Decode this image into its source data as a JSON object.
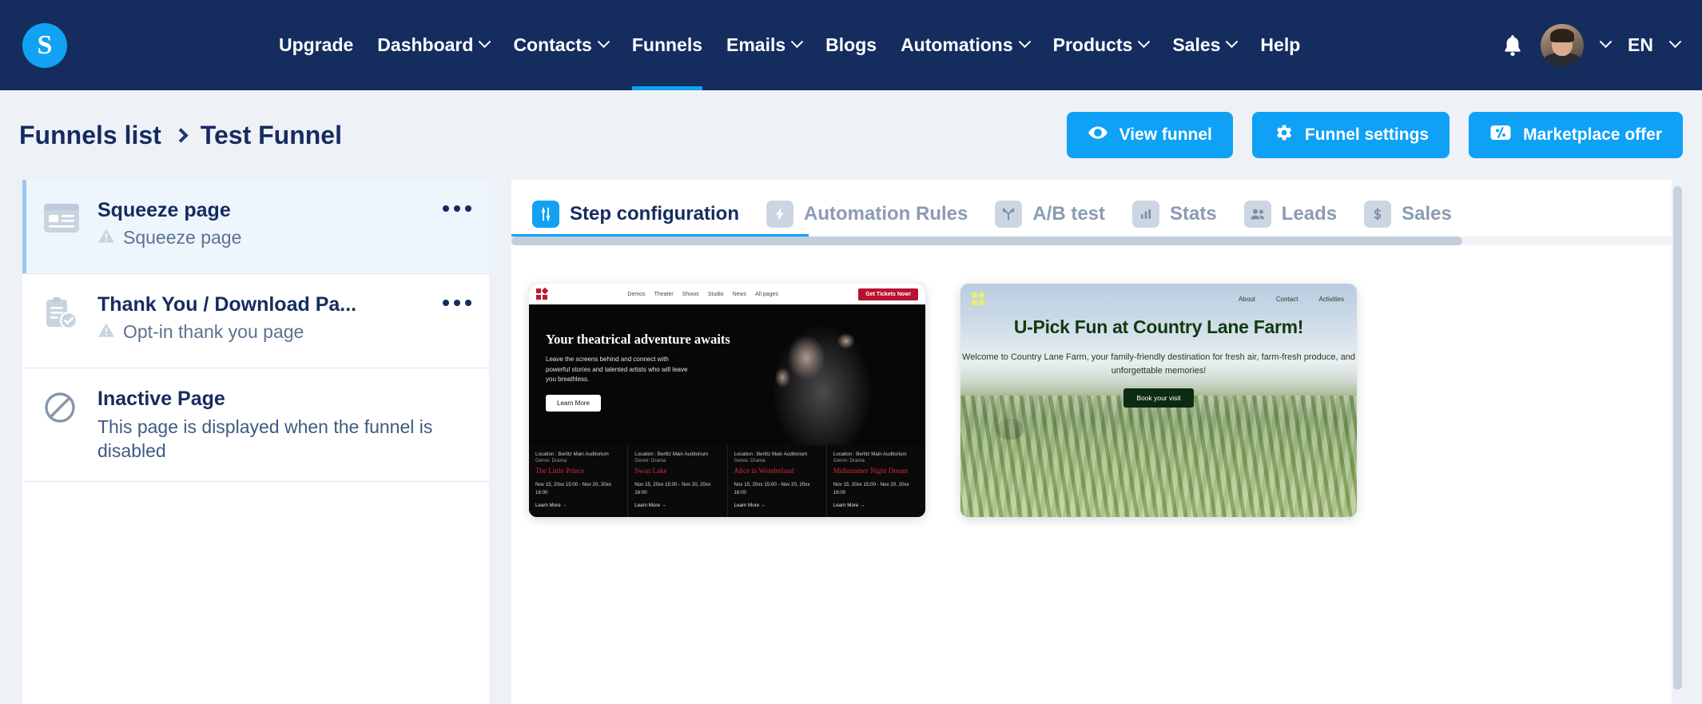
{
  "navbar": {
    "logo_letter": "S",
    "items": [
      {
        "label": "Upgrade",
        "caret": false,
        "active": false
      },
      {
        "label": "Dashboard",
        "caret": true,
        "active": false
      },
      {
        "label": "Contacts",
        "caret": true,
        "active": false
      },
      {
        "label": "Funnels",
        "caret": false,
        "active": true
      },
      {
        "label": "Emails",
        "caret": true,
        "active": false
      },
      {
        "label": "Blogs",
        "caret": false,
        "active": false
      },
      {
        "label": "Automations",
        "caret": true,
        "active": false
      },
      {
        "label": "Products",
        "caret": true,
        "active": false
      },
      {
        "label": "Sales",
        "caret": true,
        "active": false
      },
      {
        "label": "Help",
        "caret": false,
        "active": false
      }
    ],
    "notification_icon": "bell-icon",
    "avatar_icon": "user-avatar",
    "language": "EN"
  },
  "subheader": {
    "breadcrumb_root": "Funnels list",
    "breadcrumb_current": "Test Funnel",
    "buttons": [
      {
        "label": "View funnel",
        "icon": "eye-icon"
      },
      {
        "label": "Funnel settings",
        "icon": "gear-icon"
      },
      {
        "label": "Marketplace offer",
        "icon": "ticket-percent-icon"
      }
    ]
  },
  "sidebar": {
    "pages": [
      {
        "title": "Squeeze page",
        "subtitle": "Squeeze page",
        "warning": true,
        "icon": "squeeze-page-icon",
        "selected": true,
        "menu": "..."
      },
      {
        "title": "Thank You / Download Pa...",
        "subtitle": "Opt-in thank you page",
        "warning": true,
        "icon": "thank-you-page-icon",
        "selected": false,
        "menu": "..."
      },
      {
        "title": "Inactive Page",
        "description": "This page is displayed when the funnel is disabled",
        "warning": false,
        "icon": "blocked-icon",
        "selected": false
      }
    ]
  },
  "main": {
    "tabs": [
      {
        "label": "Step configuration",
        "icon": "sliders-icon",
        "active": true
      },
      {
        "label": "Automation Rules",
        "icon": "bolt-icon",
        "active": false
      },
      {
        "label": "A/B test",
        "icon": "branch-icon",
        "active": false
      },
      {
        "label": "Stats",
        "icon": "bar-chart-icon",
        "active": false
      },
      {
        "label": "Leads",
        "icon": "people-icon",
        "active": false
      },
      {
        "label": "Sales",
        "icon": "dollar-icon",
        "active": false
      }
    ],
    "templates": [
      {
        "id": "theatre-template",
        "nav_links": [
          "Demos",
          "Theater",
          "Shows",
          "Studio",
          "News",
          "All pages"
        ],
        "cta": "Get Tickets Now!",
        "heading": "Your theatrical adventure awaits",
        "paragraph": "Leave the screens behind and connect with powerful stories and talented artists who will leave you breathless.",
        "button": "Learn More",
        "cards": [
          {
            "location": "Location : Berlitz Main Auditorium",
            "genre": "Genre: Drama",
            "name": "The Little Prince",
            "date": "Nov 15, 20xx 15:00 - Nov 20, 20xx 16:00",
            "more": "Learn More  →"
          },
          {
            "location": "Location : Berlitz Main Auditorium",
            "genre": "Genre: Drama",
            "name": "Swan Lake",
            "date": "Nov 15, 20xx 15:00 - Nov 20, 20xx 16:00",
            "more": "Learn More  →"
          },
          {
            "location": "Location : Berlitz Main Auditorium",
            "genre": "Genre: Drama",
            "name": "Alice in Wonderland",
            "date": "Nov 15, 20xx 15:00 - Nov 20, 20xx 16:00",
            "more": "Learn More  →"
          },
          {
            "location": "Location : Berlitz Main Auditorium",
            "genre": "Genre: Drama",
            "name": "Midsummer Night Dream",
            "date": "Nov 15, 20xx 15:00 - Nov 20, 20xx 16:00",
            "more": "Learn More  →"
          }
        ]
      },
      {
        "id": "farm-template",
        "nav_links": [
          "About",
          "Contact",
          "Activities"
        ],
        "heading": "U-Pick Fun at Country Lane Farm!",
        "paragraph": "Welcome to Country Lane Farm, your family-friendly destination for fresh air, farm-fresh produce, and unforgettable memories!",
        "button": "Book your visit"
      }
    ]
  },
  "colors": {
    "navbar_bg": "#152c5f",
    "accent_blue": "#0fa1f5",
    "page_bg": "#eef2f7",
    "selected_bg": "#eef6fd",
    "text_dark": "#152c5f",
    "muted": "#8b9bb4"
  }
}
